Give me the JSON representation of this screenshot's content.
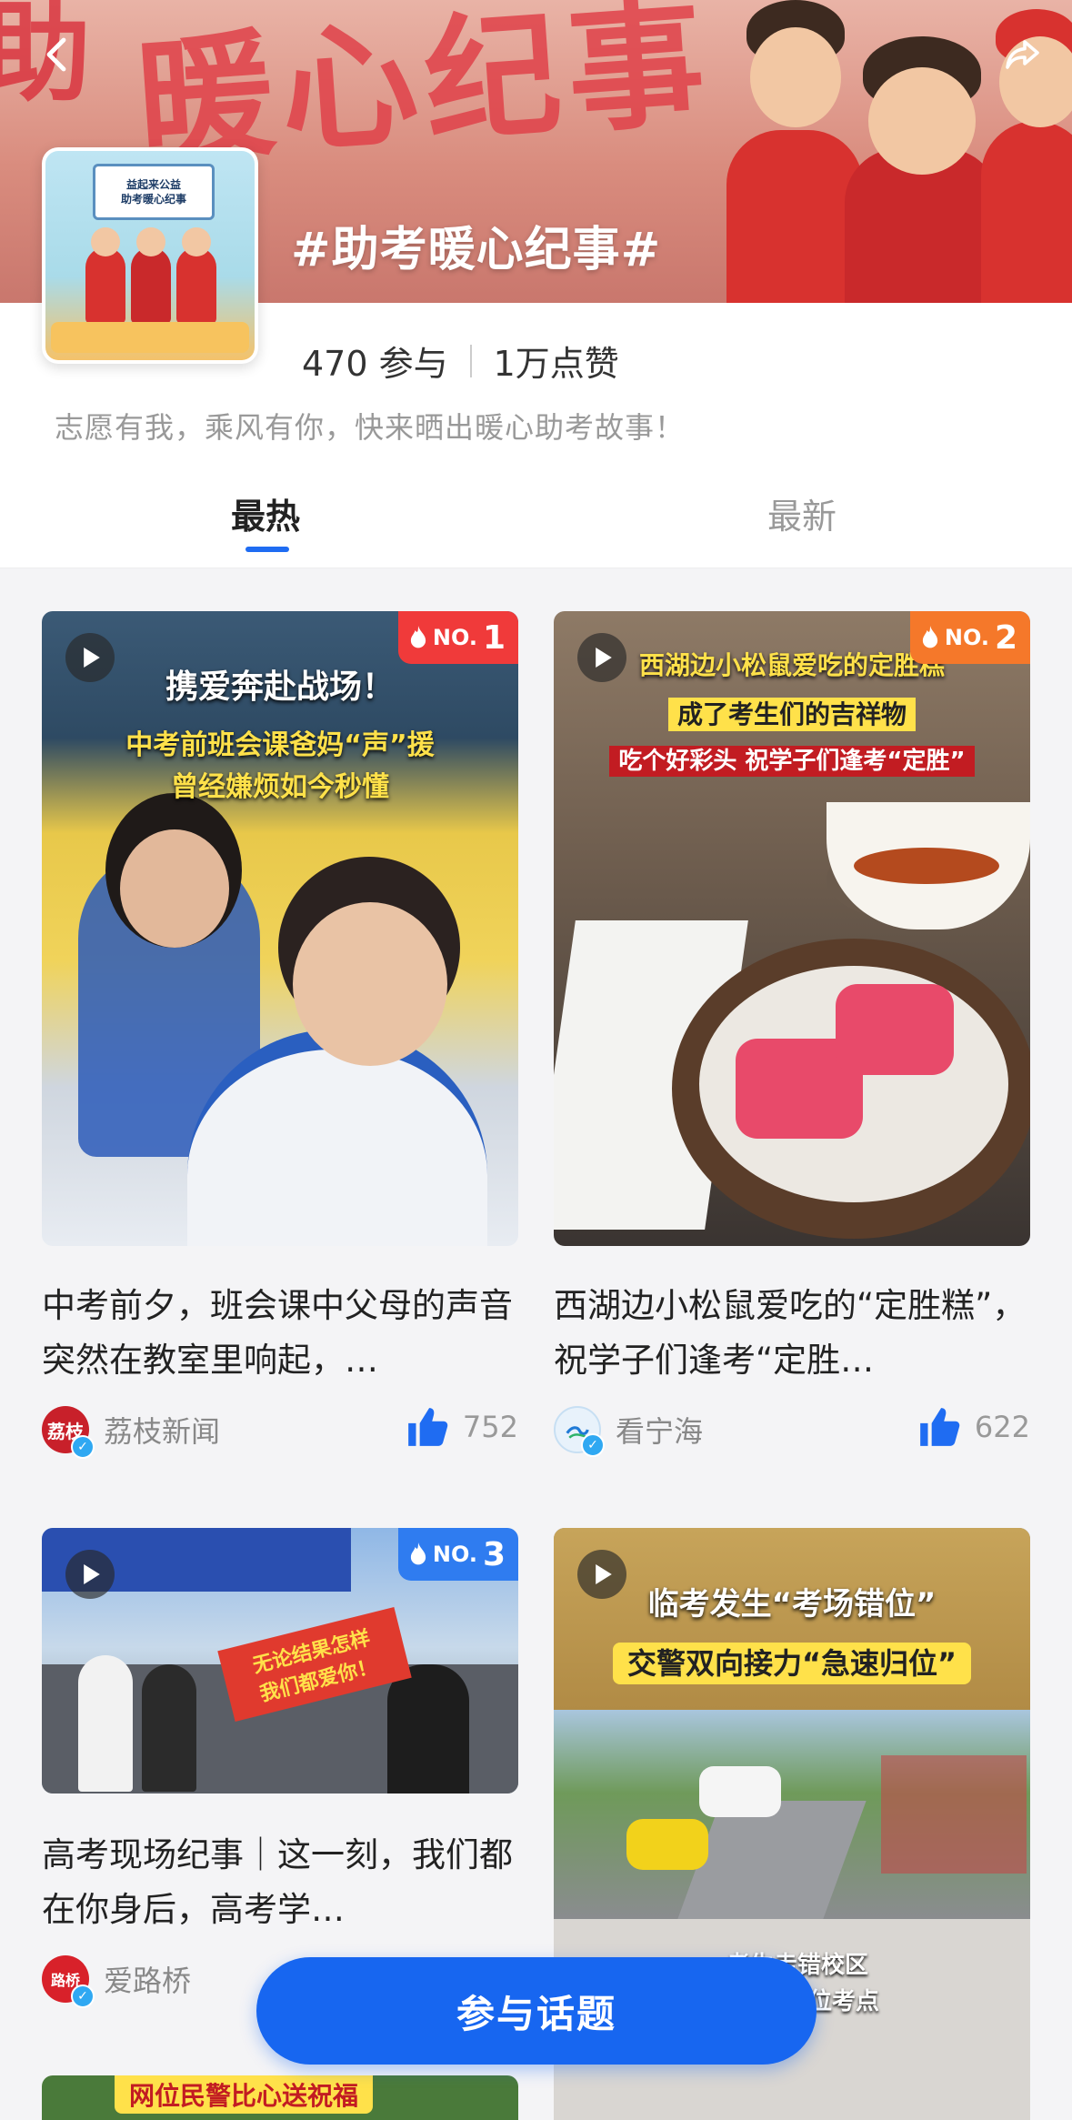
{
  "header": {
    "topic_title": "#助考暖心纪事#",
    "cover_sign_line1": "益起来公益",
    "cover_sign_line2": "助考暖心纪事",
    "banner_text": "暖心纪事"
  },
  "stats": {
    "participants": "470 参与",
    "likes": "1万点赞"
  },
  "description": "志愿有我，乘风有你，快来晒出暖心助考故事！",
  "tabs": [
    {
      "label": "最热",
      "active": true
    },
    {
      "label": "最新",
      "active": false
    }
  ],
  "cards": [
    {
      "rank_no": "NO.",
      "rank_num": "1",
      "overlay_line1": "携爱奔赴战场！",
      "overlay_line2": "中考前班会课爸妈“声”援",
      "overlay_line3": "曾经嫌烦如今秒懂",
      "title": "中考前夕，班会课中父母的声音突然在教室里响起，…",
      "author": "荔枝新闻",
      "avatar_text": "荔枝",
      "likes": "752"
    },
    {
      "rank_no": "NO.",
      "rank_num": "2",
      "overlay_line1": "西湖边小松鼠爱吃的定胜糕",
      "overlay_line2": "成了考生们的吉祥物",
      "overlay_line3": "吃个好彩头 祝学子们逢考“定胜”",
      "title": "西湖边小松鼠爱吃的“定胜糕”，祝学子们逢考“定胜…",
      "author": "看宁海",
      "avatar_text": "",
      "likes": "622"
    },
    {
      "rank_no": "NO.",
      "rank_num": "3",
      "overlay_line1": "无论结果怎样",
      "overlay_line2": "我们都爱你！",
      "title": "高考现场纪事｜这一刻，我们都在你身后，高考学…",
      "author": "爱路桥",
      "avatar_text": "路桥"
    },
    {
      "overlay_line1": "临考发生“考场错位”",
      "overlay_line2": "交警双向接力“急速归位”",
      "overlay_line3": "考生走错校区",
      "overlay_line4": "位考点"
    },
    {
      "overlay_line1": "网位民警比心送祝福"
    }
  ],
  "join_button": "参与话题",
  "colors": {
    "accent": "#1766f0",
    "rank1": "#f03a3a",
    "rank2": "#f5782a",
    "rank3": "#2f7cf0"
  }
}
